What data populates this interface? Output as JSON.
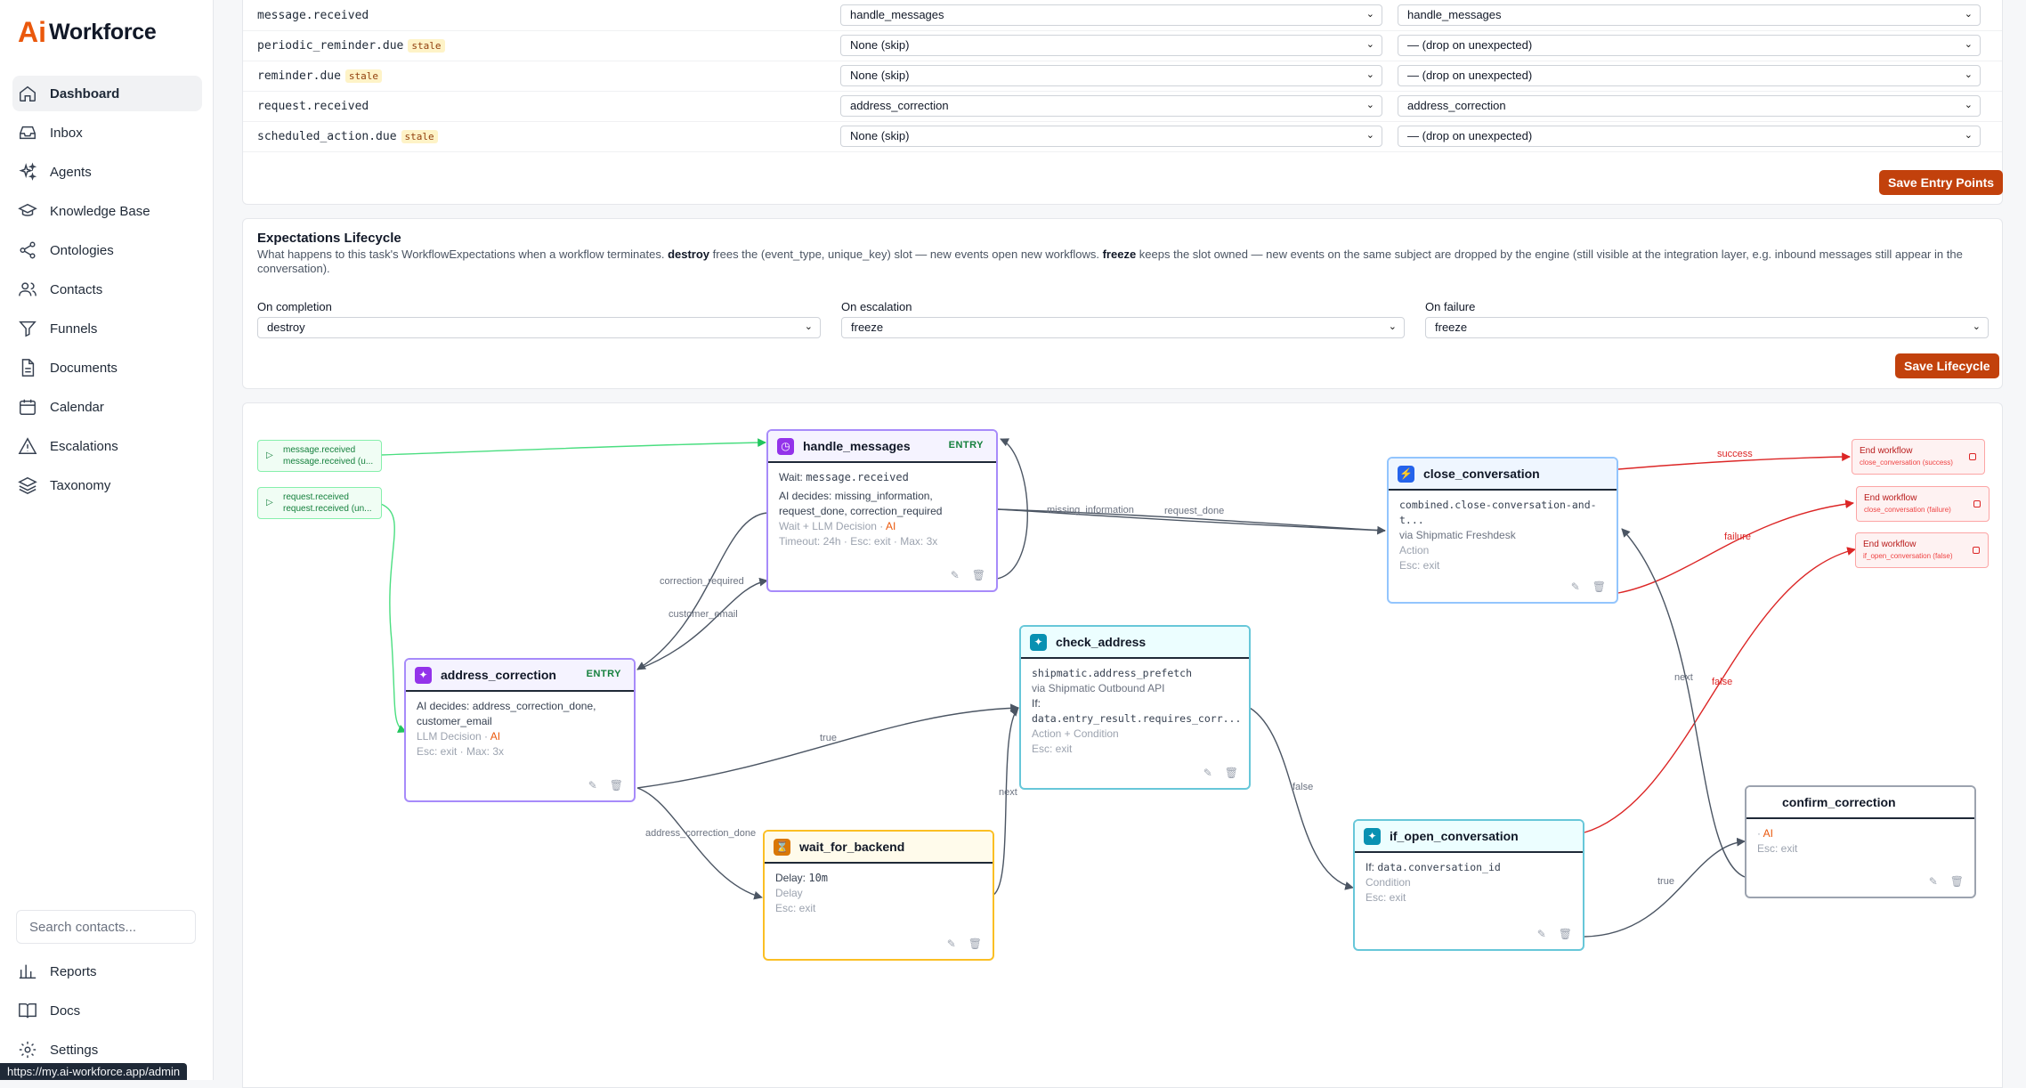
{
  "app": {
    "logo_ai": "Ai",
    "logo_name": "Workforce"
  },
  "sidebar": {
    "items": [
      {
        "label": "Dashboard",
        "icon": "home-icon"
      },
      {
        "label": "Inbox",
        "icon": "inbox-icon"
      },
      {
        "label": "Agents",
        "icon": "sparkles-icon"
      },
      {
        "label": "Knowledge Base",
        "icon": "graduation-cap-icon"
      },
      {
        "label": "Ontologies",
        "icon": "share-icon"
      },
      {
        "label": "Contacts",
        "icon": "users-icon"
      },
      {
        "label": "Funnels",
        "icon": "funnel-icon"
      },
      {
        "label": "Documents",
        "icon": "document-icon"
      },
      {
        "label": "Calendar",
        "icon": "calendar-icon"
      },
      {
        "label": "Escalations",
        "icon": "warning-icon"
      },
      {
        "label": "Taxonomy",
        "icon": "layers-icon"
      }
    ],
    "search_placeholder": "Search contacts...",
    "bottom_items": [
      {
        "label": "Reports",
        "icon": "bar-chart-icon"
      },
      {
        "label": "Docs",
        "icon": "book-icon"
      },
      {
        "label": "Settings",
        "icon": "gear-icon"
      }
    ],
    "status_url": "https://my.ai-workforce.app/admin"
  },
  "entry_points": {
    "rows": [
      {
        "event": "message.received",
        "stale": false,
        "stale_label": "",
        "handler": "handle_messages",
        "fallback": "handle_messages"
      },
      {
        "event": "periodic_reminder.due",
        "stale": true,
        "stale_label": "stale",
        "handler": "None (skip)",
        "fallback": "— (drop on unexpected)"
      },
      {
        "event": "reminder.due",
        "stale": true,
        "stale_label": "stale",
        "handler": "None (skip)",
        "fallback": "— (drop on unexpected)"
      },
      {
        "event": "request.received",
        "stale": false,
        "stale_label": "",
        "handler": "address_correction",
        "fallback": "address_correction"
      },
      {
        "event": "scheduled_action.due",
        "stale": true,
        "stale_label": "stale",
        "handler": "None (skip)",
        "fallback": "— (drop on unexpected)"
      }
    ],
    "save_label": "Save Entry Points"
  },
  "lifecycle": {
    "title": "Expectations Lifecycle",
    "desc_1": "What happens to this task's WorkflowExpectations when a workflow terminates.",
    "desc_destroy": "destroy",
    "desc_2": "frees the (event_type, unique_key) slot — new events open new workflows.",
    "desc_freeze": "freeze",
    "desc_3": "keeps the slot owned — new events on the same subject are dropped by the engine (still visible at the integration layer, e.g. inbound messages still appear in the conversation).",
    "completion_label": "On completion",
    "completion_value": "destroy",
    "escalation_label": "On escalation",
    "escalation_value": "freeze",
    "failure_label": "On failure",
    "failure_value": "freeze",
    "save_label": "Save Lifecycle"
  },
  "graph": {
    "triggers": [
      {
        "line1": "message.received",
        "line2": "message.received (u..."
      },
      {
        "line1": "request.received",
        "line2": "request.received (un..."
      }
    ],
    "entry_badge": "ENTRY",
    "nodes": {
      "handle_messages": {
        "name": "handle_messages",
        "wait_label": "Wait:",
        "wait_value": "message.received",
        "decides": "AI decides: missing_information, request_done, correction_required",
        "type": "Wait + LLM Decision",
        "ai": "AI",
        "meta": "Timeout: 24h · Esc: exit · Max: 3x"
      },
      "address_correction": {
        "name": "address_correction",
        "decides": "AI decides: address_correction_done, customer_email",
        "type": "LLM Decision",
        "ai": "AI",
        "meta": "Esc: exit · Max: 3x"
      },
      "check_address": {
        "name": "check_address",
        "action": "shipmatic.address_prefetch",
        "via": "via Shipmatic Outbound API",
        "if_label": "If:",
        "if_value": "data.entry_result.requires_corr...",
        "type": "Action + Condition",
        "meta": "Esc: exit"
      },
      "wait_for_backend": {
        "name": "wait_for_backend",
        "delay_label": "Delay:",
        "delay_value": "10m",
        "type": "Delay",
        "meta": "Esc: exit"
      },
      "close_conversation": {
        "name": "close_conversation",
        "action": "combined.close-conversation-and-t...",
        "via": "via Shipmatic Freshdesk",
        "type": "Action",
        "meta": "Esc: exit"
      },
      "if_open_conversation": {
        "name": "if_open_conversation",
        "if_label": "If:",
        "if_value": "data.conversation_id",
        "type": "Condition",
        "meta": "Esc: exit"
      },
      "confirm_correction": {
        "name": "confirm_correction",
        "ai": "AI",
        "meta": "Esc: exit"
      }
    },
    "end_nodes": [
      {
        "title": "End workflow",
        "sub": "close_conversation (success)"
      },
      {
        "title": "End workflow",
        "sub": "close_conversation (failure)"
      },
      {
        "title": "End workflow",
        "sub": "if_open_conversation (false)"
      }
    ],
    "edge_labels": {
      "missing_information": "missing_information",
      "request_done": "request_done",
      "correction_required": "correction_required",
      "customer_email": "customer_email",
      "true1": "true",
      "next1": "next",
      "address_correction_done": "address_correction_done",
      "false1": "false",
      "success": "success",
      "failure": "failure",
      "next2": "next",
      "false2": "false",
      "true2": "true"
    }
  }
}
